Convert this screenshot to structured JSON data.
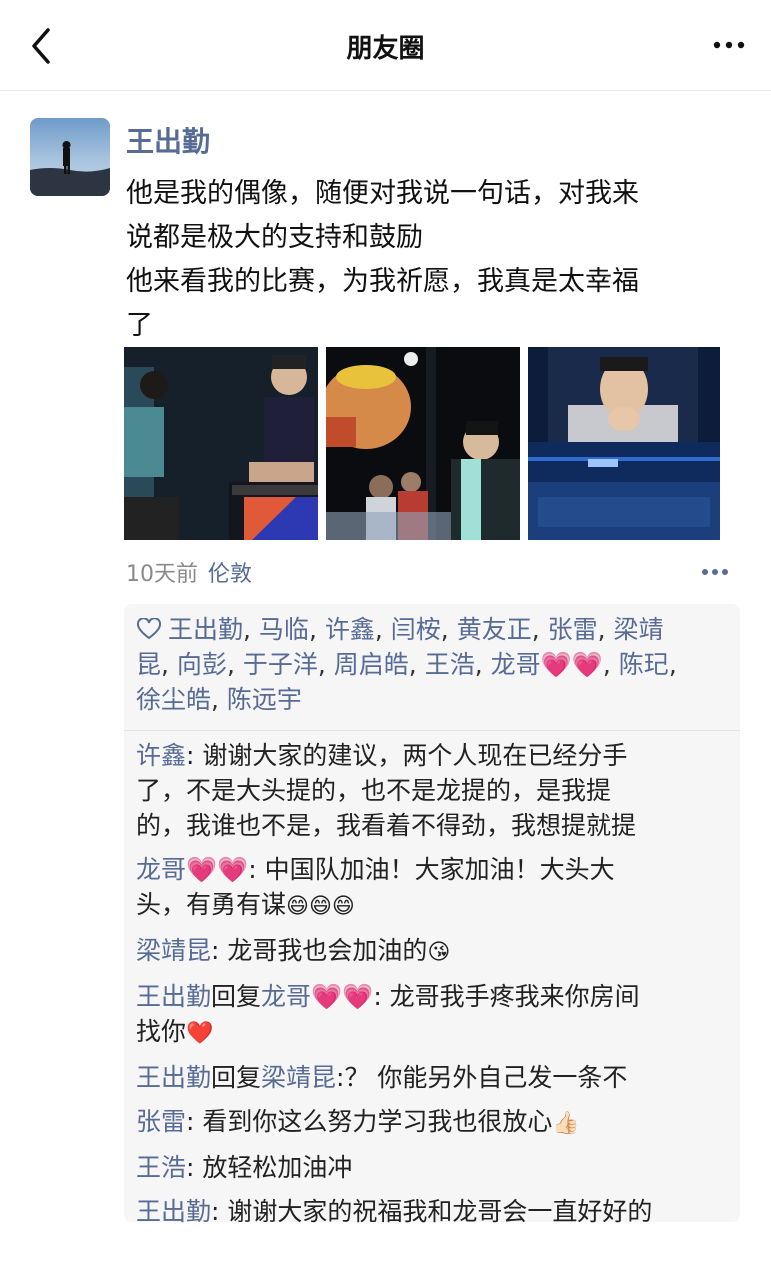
{
  "header": {
    "title": "朋友圈"
  },
  "post": {
    "author": "王出勤",
    "text": "他是我的偶像，随便对我说一句话，对我来\n说都是极大的支持和鼓励\n他来看我的比赛，为我祈愿，我真是太幸福\n了",
    "time": "10天前",
    "location": "伦敦"
  },
  "likes": {
    "names": [
      "王出勤",
      "马临",
      "许鑫",
      "闫桉",
      "黄友正",
      "张雷",
      "梁靖\n昆",
      "向彭",
      "于子洋",
      "周启皓",
      "王浩",
      "龙哥",
      "陈玘",
      "徐尘皓",
      "陈远宇"
    ],
    "heart_emoji": "💗💗"
  },
  "comments": [
    {
      "name": "许鑫",
      "text": ": 谢谢大家的建议，两个人现在已经分手\n了，不是大头提的，也不是龙提的，是我提\n的，我谁也不是，我看着不得劲，我想提就提"
    },
    {
      "name": "龙哥",
      "emoji": "💗💗",
      "text": ": 中国队加油！大家加油！大头大\n头，有勇有谋",
      "trail": "😄😄😄"
    },
    {
      "name": "梁靖昆",
      "text": ": 龙哥我也会加油的",
      "trail": "😘"
    },
    {
      "name": "王出勤",
      "reply_word": "回复",
      "reply_to": "龙哥",
      "emoji": "💗💗",
      "text": ": 龙哥我手疼我来你房间\n找你",
      "trail": "❤️"
    },
    {
      "name": "王出勤",
      "reply_word": "回复",
      "reply_to": "梁靖昆",
      "text": ":？ 你能另外自己发一条不"
    },
    {
      "name": "张雷",
      "text": ": 看到你这么努力学习我也很放心",
      "trail": "👍🏻"
    },
    {
      "name": "王浩",
      "text": ": 放轻松加油冲"
    },
    {
      "name": "王出勤",
      "text": ": 谢谢大家的祝福我和龙哥会一直好好的"
    }
  ],
  "icons": {
    "back": "chevron-left-icon",
    "more": "more-horizontal-icon",
    "like": "heart-outline-icon",
    "post_menu": "more-horizontal-icon"
  },
  "colors": {
    "link": "#576b95",
    "panel_bg": "#f6f6f6",
    "text": "#111111",
    "meta": "#8a8a8a"
  }
}
